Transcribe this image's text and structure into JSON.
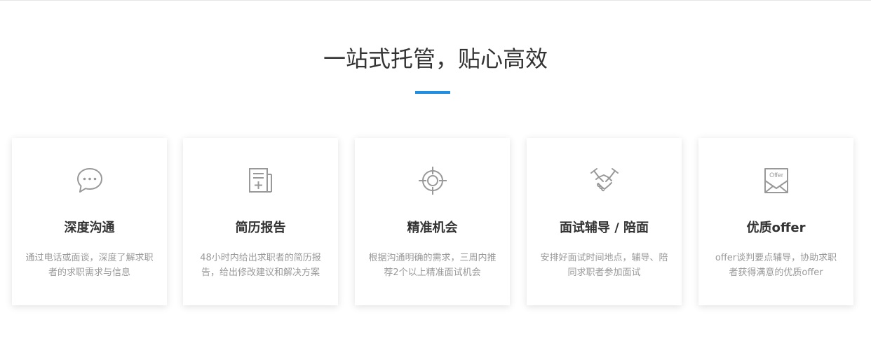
{
  "section": {
    "title": "一站式托管，贴心高效",
    "accent_color": "#1e8fe1"
  },
  "cards": [
    {
      "icon": "chat-bubble-icon",
      "title": "深度沟通",
      "description": "通过电话或面谈，深度了解求职者的求职需求与信息"
    },
    {
      "icon": "resume-report-icon",
      "title": "简历报告",
      "description": "48小时内给出求职者的简历报告，给出修改建议和解决方案"
    },
    {
      "icon": "crosshair-target-icon",
      "title": "精准机会",
      "description": "根据沟通明确的需求，三周内推荐2个以上精准面试机会"
    },
    {
      "icon": "handshake-icon",
      "title": "面试辅导 / 陪面",
      "description": "安排好面试时间地点，辅导、陪同求职者参加面试"
    },
    {
      "icon": "offer-envelope-icon",
      "title": "优质offer",
      "description": "offer谈判要点辅导，协助求职者获得满意的优质offer",
      "icon_text": "Offer"
    }
  ]
}
